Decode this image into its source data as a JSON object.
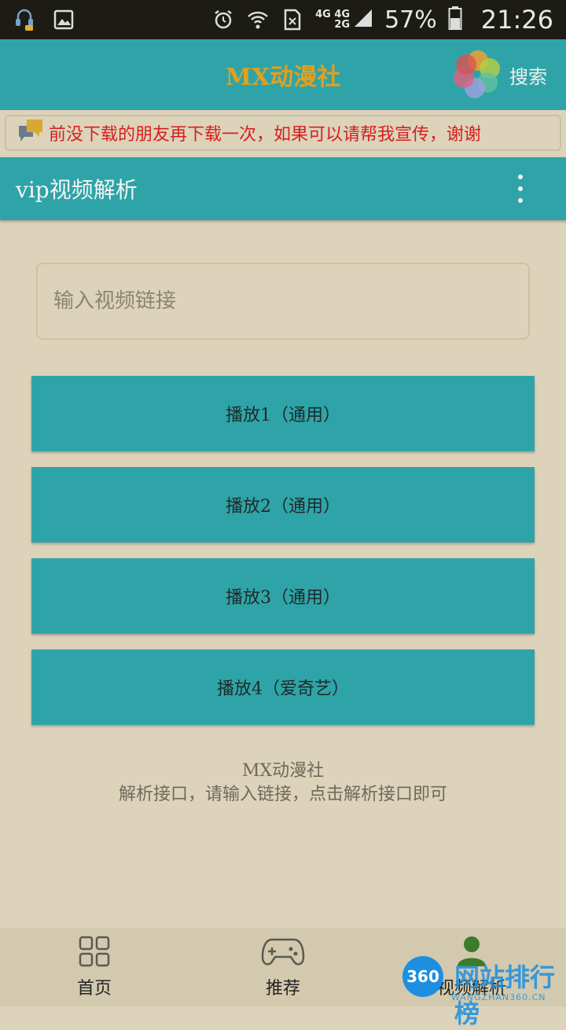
{
  "status_bar": {
    "net_top": "4G 4G",
    "net_bottom": "2G",
    "battery_percent": "57%",
    "time": "21:26"
  },
  "header": {
    "title": "MX动漫社",
    "title_color": "#e0a020",
    "search_label": "搜索"
  },
  "notice": {
    "text": "前没下载的朋友再下载一次，如果可以请帮我宣传，谢谢",
    "color": "#d81e1e"
  },
  "sub_header": {
    "title": "vip视频解析"
  },
  "url_input": {
    "placeholder": "输入视频链接",
    "value": ""
  },
  "play_buttons": [
    {
      "label": "播放1（通用）"
    },
    {
      "label": "播放2（通用）"
    },
    {
      "label": "播放3（通用）"
    },
    {
      "label": "播放4（爱奇艺）"
    }
  ],
  "info": {
    "line1": "MX动漫社",
    "line2": "解析接口，请输入链接，点击解析接口即可"
  },
  "bottom_nav": [
    {
      "label": "首页",
      "icon": "grid-icon"
    },
    {
      "label": "推荐",
      "icon": "gamepad-icon"
    },
    {
      "label": "视频解析",
      "icon": "person-icon"
    }
  ],
  "watermark": {
    "badge": "360",
    "title": "网站排行榜",
    "subtitle": "WANGZHAN360.CN"
  },
  "colors": {
    "accent": "#2fa4a8",
    "background": "#dcd3ba",
    "nav_background": "#d2c9ae"
  }
}
